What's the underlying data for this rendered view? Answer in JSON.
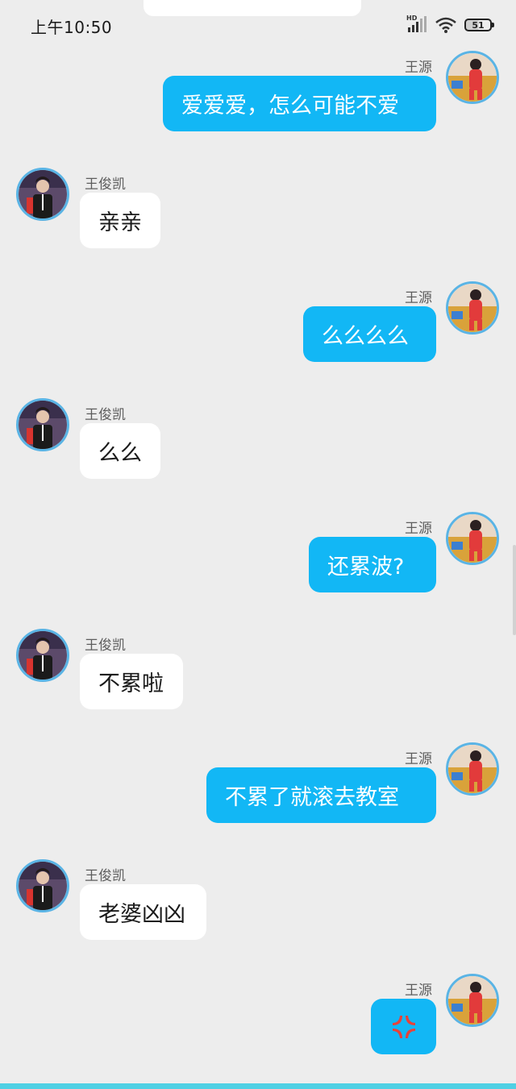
{
  "status_bar": {
    "time": "上午10:50",
    "network": "HD",
    "battery": "51"
  },
  "messages": [
    {
      "side": "right",
      "sender": "王源",
      "text": "爱爱爱，怎么可能不爱",
      "avatar": "avatar-pink-outfit"
    },
    {
      "side": "left",
      "sender": "王俊凯",
      "text": "亲亲",
      "avatar": "avatar-black-outfit"
    },
    {
      "side": "right",
      "sender": "王源",
      "text": "么么么么",
      "avatar": "avatar-pink-outfit"
    },
    {
      "side": "left",
      "sender": "王俊凯",
      "text": "么么",
      "avatar": "avatar-black-outfit"
    },
    {
      "side": "right",
      "sender": "王源",
      "text": "还累波?",
      "avatar": "avatar-pink-outfit"
    },
    {
      "side": "left",
      "sender": "王俊凯",
      "text": "不累啦",
      "avatar": "avatar-black-outfit"
    },
    {
      "side": "right",
      "sender": "王源",
      "text": "不累了就滚去教室",
      "avatar": "avatar-pink-outfit"
    },
    {
      "side": "left",
      "sender": "王俊凯",
      "text": "老婆凶凶",
      "avatar": "avatar-black-outfit"
    },
    {
      "side": "right",
      "sender": "王源",
      "text": "",
      "emoji": "anger-symbol-emoji",
      "avatar": "avatar-pink-outfit"
    }
  ],
  "colors": {
    "background": "#ededed",
    "outgoing_bubble": "#12b7f5",
    "incoming_bubble": "#ffffff",
    "avatar_ring": "#5ab4e5",
    "anger_emoji": "#e8423a",
    "bottom_accent": "#4fd0e4"
  }
}
